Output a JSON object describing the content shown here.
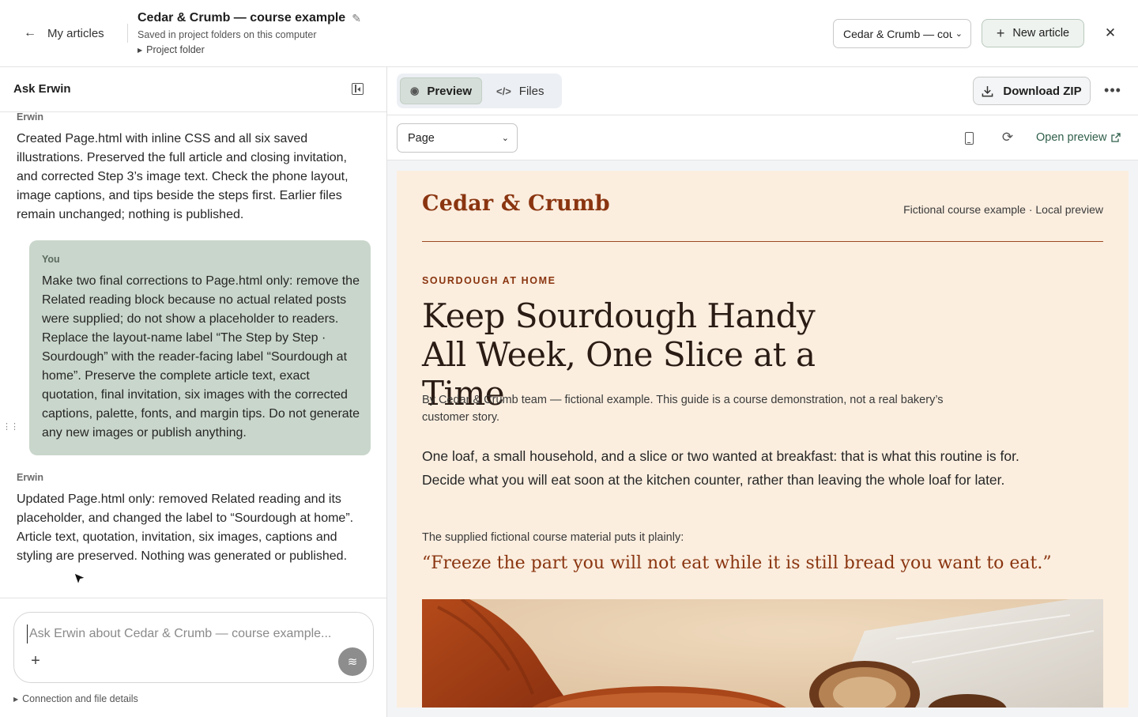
{
  "header": {
    "back_label": "My articles",
    "title": "Cedar & Crumb — course example",
    "subtitle": "Saved in project folders on this computer",
    "folder_toggle": "Project folder",
    "project_select_value": "Cedar & Crumb — course example",
    "new_article_label": "New article"
  },
  "chat": {
    "panel_title": "Ask Erwin",
    "messages": [
      {
        "author": "Erwin",
        "text": "Created Page.html with inline CSS and all six saved illustrations. Preserved the full article and closing invitation, and corrected Step 3’s image text. Check the phone layout, image captions, and tips beside the steps first. Earlier files remain unchanged; nothing is published."
      },
      {
        "author": "You",
        "text": "Make two final corrections to Page.html only: remove the Related reading block because no actual related posts were supplied; do not show a placeholder to readers. Replace the layout-name label “The Step by Step · Sourdough” with the reader-facing label “Sourdough at home”. Preserve the complete article text, exact quotation, final invitation, six images with the corrected captions, palette, fonts, and margin tips. Do not generate any new images or publish anything."
      },
      {
        "author": "Erwin",
        "text": "Updated Page.html only: removed Related reading and its placeholder, and changed the label to “Sourdough at home”. Article text, quotation, invitation, six images, captions and styling are preserved. Nothing was generated or published."
      }
    ],
    "input_placeholder": "Ask Erwin about Cedar & Crumb — course example...",
    "details_toggle": "Connection and file details"
  },
  "preview": {
    "tabs": [
      {
        "label": "Preview",
        "icon": "eye-icon",
        "active": true
      },
      {
        "label": "Files",
        "icon": "code-icon",
        "active": false
      }
    ],
    "download_label": "Download ZIP",
    "page_select_value": "Page",
    "open_preview_label": "Open preview"
  },
  "article": {
    "brand": "Cedar & Crumb",
    "meta": "Fictional course example · Local preview",
    "kicker": "SOURDOUGH AT HOME",
    "headline": "Keep Sourdough Handy All Week, One Slice at a Time",
    "byline": "By Cedar & Crumb team — fictional example. This guide is a course demonstration, not a real bakery’s customer story.",
    "lede": "One loaf, a small household, and a slice or two wanted at breakfast: that is what this routine is for. Decide what you will eat soon at the kitchen counter, rather than leaving the whole loaf for later.",
    "quote_intro": "The supplied fictional course material puts it plainly:",
    "quote": "“Freeze the part you will not eat while it is still bread you want to eat.”"
  },
  "colors": {
    "accent": "#8a3510",
    "article_bg": "#fbeedf",
    "user_bubble": "#c9d6cb",
    "active_tab": "#d5ded8"
  }
}
